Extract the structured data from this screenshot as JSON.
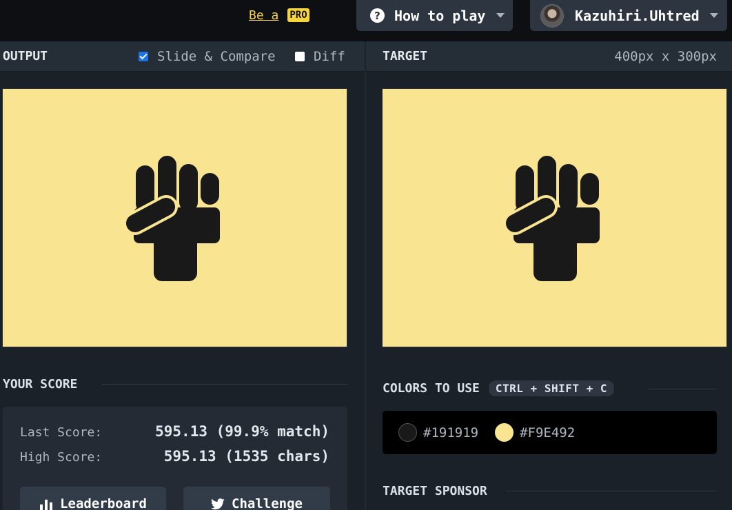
{
  "topbar": {
    "be_a": "Be a",
    "pro_badge": "PRO",
    "how_to_play": "How to play",
    "username": "Kazuhiri.Uhtred"
  },
  "output": {
    "title": "OUTPUT",
    "slide_compare": "Slide & Compare",
    "slide_compare_checked": true,
    "diff": "Diff",
    "diff_checked": false
  },
  "target": {
    "title": "TARGET",
    "size": "400px x 300px"
  },
  "score": {
    "title": "YOUR SCORE",
    "last_label": "Last Score:",
    "last_value": "595.13 (99.9% match)",
    "high_label": "High Score:",
    "high_value": "595.13 (1535 chars)",
    "leaderboard_button": "Leaderboard",
    "challenge_button": "Challenge"
  },
  "colors": {
    "title": "COLORS TO USE",
    "shortcut": "CTRL + SHIFT + C",
    "items": [
      {
        "hex": "#191919",
        "label": "#191919"
      },
      {
        "hex": "#F9E492",
        "label": "#F9E492"
      }
    ]
  },
  "sponsor": {
    "title": "TARGET SPONSOR"
  },
  "icons": [
    "question-icon",
    "chevron-down-icon",
    "avatar",
    "bar-chart-icon",
    "twitter-icon"
  ]
}
